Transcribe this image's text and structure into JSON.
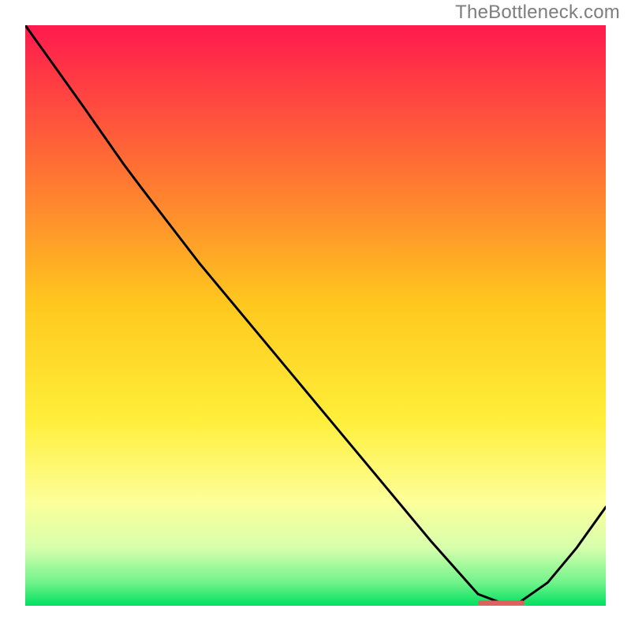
{
  "attribution": "TheBottleneck.com",
  "colors": {
    "gradient_top": "#ff1a4e",
    "gradient_mid_upper": "#ff8b2e",
    "gradient_mid": "#ffd21f",
    "gradient_mid_lower": "#fff98e",
    "gradient_lower_fade": "#e8ffb4",
    "gradient_bottom": "#00e060",
    "line": "#000000",
    "marker": "#e06060"
  },
  "chart_data": {
    "type": "line",
    "title": "",
    "xlabel": "",
    "ylabel": "",
    "xlim": [
      0,
      100
    ],
    "ylim": [
      0,
      100
    ],
    "series": [
      {
        "name": "curve",
        "x": [
          0,
          5,
          10,
          17,
          20,
          30,
          40,
          50,
          60,
          70,
          78,
          82,
          85,
          90,
          95,
          100
        ],
        "y": [
          100,
          93,
          86,
          76,
          72,
          59,
          47,
          35,
          23,
          11,
          2,
          0.5,
          0.5,
          4,
          10,
          17
        ]
      }
    ],
    "optimal_marker": {
      "x_start": 78,
      "x_end": 86,
      "y": 0.5
    },
    "gradient_stops": [
      {
        "offset": 0,
        "color": "#ff1a4e"
      },
      {
        "offset": 24,
        "color": "#ff6e34"
      },
      {
        "offset": 48,
        "color": "#ffc81e"
      },
      {
        "offset": 68,
        "color": "#ffef3a"
      },
      {
        "offset": 82,
        "color": "#fdff99"
      },
      {
        "offset": 90,
        "color": "#d7ffad"
      },
      {
        "offset": 96,
        "color": "#71f38b"
      },
      {
        "offset": 100,
        "color": "#00e060"
      }
    ]
  }
}
